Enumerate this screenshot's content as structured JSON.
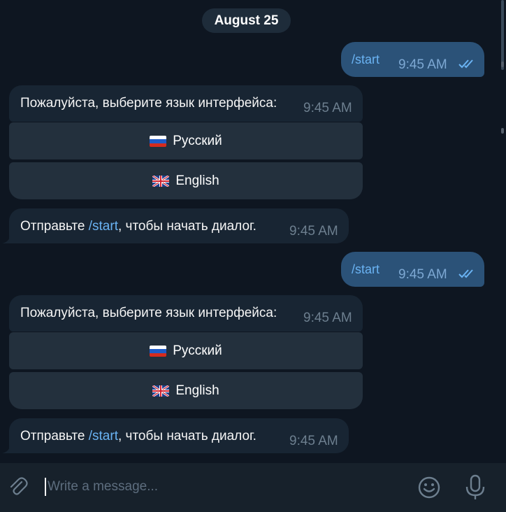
{
  "date_label": "August 25",
  "outgoing": [
    {
      "text": "/start",
      "time": "9:45 AM"
    },
    {
      "text": "/start",
      "time": "9:45 AM"
    }
  ],
  "incoming": [
    {
      "text": "Пожалуйста, выберите язык интерфейса:",
      "time": "9:45 AM"
    },
    {
      "text_before": "Отправьте ",
      "link": "/start",
      "text_after": ", чтобы начать диалог.",
      "time": "9:45 AM"
    },
    {
      "text": "Пожалуйста, выберите язык интерфейса:",
      "time": "9:45 AM"
    },
    {
      "text_before": "Отправьте ",
      "link": "/start",
      "text_after": ", чтобы начать диалог.",
      "time": "9:45 AM"
    }
  ],
  "keyboard": {
    "russian": "Русский",
    "english": "English"
  },
  "composer": {
    "placeholder": "Write a message..."
  },
  "icons": {
    "attach": "paperclip-icon",
    "emoji": "smiley-icon",
    "mic": "microphone-icon",
    "read": "double-check-icon"
  },
  "colors": {
    "background": "#0e1621",
    "outgoing_bubble": "#2b5278",
    "incoming_bubble": "#182533",
    "keyboard_button": "#23303d",
    "link": "#6ab3f3"
  }
}
